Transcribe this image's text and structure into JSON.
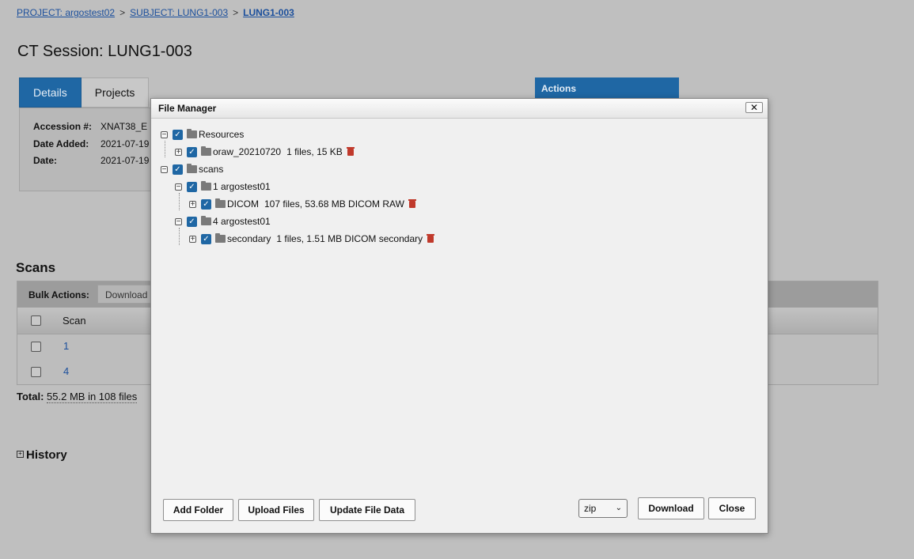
{
  "breadcrumb": {
    "project": "PROJECT: argostest02",
    "subject": "SUBJECT: LUNG1-003",
    "current": "LUNG1-003",
    "sep": ">"
  },
  "page_title": "CT Session: LUNG1-003",
  "tabs": {
    "details": "Details",
    "projects": "Projects"
  },
  "details": {
    "accession_label": "Accession #:",
    "accession_value": "XNAT38_E",
    "date_added_label": "Date Added:",
    "date_added_value": "2021-07-19",
    "date_label": "Date:",
    "date_value": "2021-07-19"
  },
  "actions_label": "Actions",
  "scans": {
    "heading": "Scans",
    "bulk_label": "Bulk Actions:",
    "bulk_button": "Download",
    "column_scan": "Scan",
    "rows": [
      "1",
      "4"
    ],
    "total_label": "Total:",
    "total_value": "55.2 MB in 108 files"
  },
  "history_label": "History",
  "file_manager": {
    "title": "File Manager",
    "close_x": "✕",
    "tree": {
      "resources": "Resources",
      "oraw_name": "oraw_20210720",
      "oraw_info": "1 files, 15 KB",
      "scans": "scans",
      "scan1": "1 argostest01",
      "dicom_name": "DICOM",
      "dicom_info": "107 files, 53.68 MB DICOM RAW",
      "scan4": "4 argostest01",
      "secondary_name": "secondary",
      "secondary_info": "1 files, 1.51 MB DICOM secondary"
    },
    "buttons": {
      "add_folder": "Add Folder",
      "upload_files": "Upload Files",
      "update_file_data": "Update File Data",
      "format": "zip",
      "download": "Download",
      "close": "Close"
    }
  }
}
